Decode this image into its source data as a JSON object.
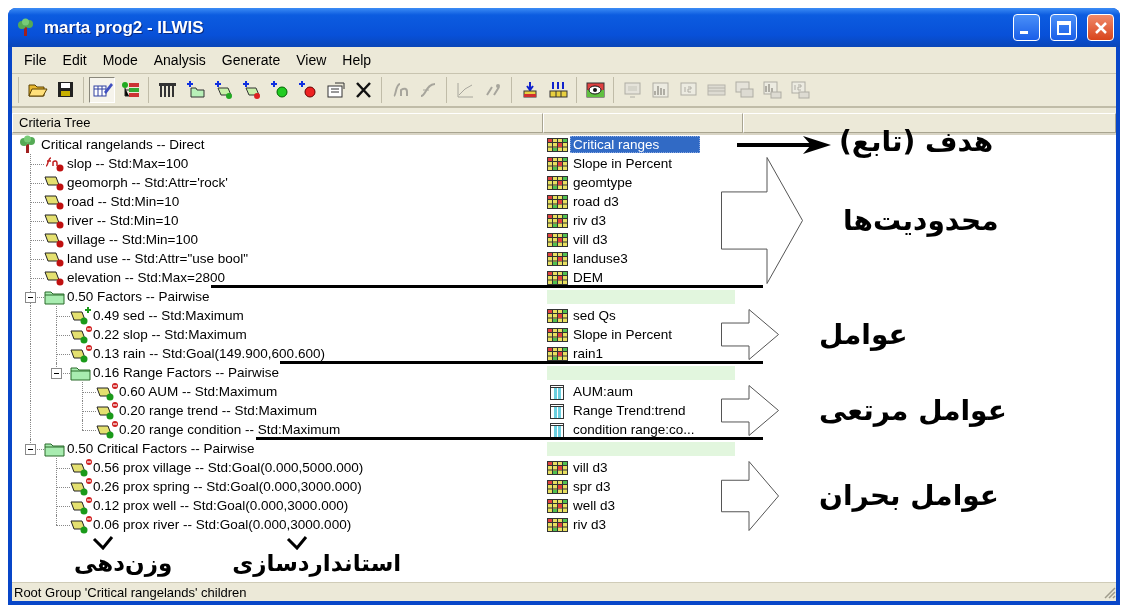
{
  "window": {
    "title": "marta prog2 - ILWIS"
  },
  "menu": [
    "File",
    "Edit",
    "Mode",
    "Analysis",
    "Generate",
    "View",
    "Help"
  ],
  "toolbar": [
    {
      "items": [
        {
          "kind": "open",
          "disabled": false,
          "pressed": false
        },
        {
          "kind": "save",
          "disabled": false,
          "pressed": false
        }
      ]
    },
    {
      "items": [
        {
          "kind": "edit-mode",
          "disabled": false,
          "pressed": true
        },
        {
          "kind": "tree-mode",
          "disabled": false,
          "pressed": false
        }
      ]
    },
    {
      "items": [
        {
          "kind": "columns",
          "disabled": false,
          "pressed": false
        },
        {
          "kind": "add-group",
          "disabled": false,
          "pressed": false
        },
        {
          "kind": "add-constraint",
          "disabled": false,
          "pressed": false
        },
        {
          "kind": "add-factor",
          "disabled": false,
          "pressed": false
        },
        {
          "kind": "add-benefit",
          "disabled": false,
          "pressed": false
        },
        {
          "kind": "add-cost",
          "disabled": false,
          "pressed": false
        },
        {
          "kind": "properties",
          "disabled": false,
          "pressed": false
        },
        {
          "kind": "delete",
          "disabled": false,
          "pressed": false
        }
      ]
    },
    {
      "items": [
        {
          "kind": "function",
          "disabled": true,
          "pressed": false
        },
        {
          "kind": "curve",
          "disabled": true,
          "pressed": false
        }
      ]
    },
    {
      "items": [
        {
          "kind": "graph",
          "disabled": true,
          "pressed": false
        },
        {
          "kind": "weights",
          "disabled": true,
          "pressed": false
        }
      ]
    },
    {
      "items": [
        {
          "kind": "stack",
          "disabled": false,
          "pressed": false
        },
        {
          "kind": "multi-stack",
          "disabled": false,
          "pressed": false
        }
      ]
    },
    {
      "items": [
        {
          "kind": "show-map",
          "disabled": false,
          "pressed": false
        }
      ]
    },
    {
      "items": [
        {
          "kind": "display",
          "disabled": true,
          "pressed": false
        },
        {
          "kind": "histogram",
          "disabled": true,
          "pressed": false
        },
        {
          "kind": "value",
          "disabled": true,
          "pressed": false
        },
        {
          "kind": "table",
          "disabled": true,
          "pressed": false
        },
        {
          "kind": "display-all",
          "disabled": true,
          "pressed": false
        },
        {
          "kind": "histogram-all",
          "disabled": true,
          "pressed": false
        },
        {
          "kind": "value-all",
          "disabled": true,
          "pressed": false
        }
      ]
    }
  ],
  "tree": {
    "header": "Criteria Tree",
    "root": {
      "kind": "root",
      "label": "Critical rangelands -- Direct",
      "map": {
        "kind": "raster",
        "label": "Critical ranges",
        "selected": true
      },
      "children": [
        {
          "kind": "function",
          "label": "slop -- Std:Max=100",
          "map": {
            "kind": "raster",
            "label": "Slope in Percent",
            "selected": false
          }
        },
        {
          "kind": "constraint",
          "label": "geomorph -- Std:Attr='rock'",
          "map": {
            "kind": "raster",
            "label": "geomtype",
            "selected": false
          }
        },
        {
          "kind": "constraint",
          "label": "road -- Std:Min=10",
          "map": {
            "kind": "raster",
            "label": "road d3",
            "selected": false
          }
        },
        {
          "kind": "constraint",
          "label": "river -- Std:Min=10",
          "map": {
            "kind": "raster",
            "label": "riv d3",
            "selected": false
          }
        },
        {
          "kind": "constraint",
          "label": "village -- Std:Min=100",
          "map": {
            "kind": "raster",
            "label": "vill d3",
            "selected": false
          }
        },
        {
          "kind": "constraint",
          "label": "land use -- Std:Attr=\"use bool\"",
          "map": {
            "kind": "raster",
            "label": "landuse3",
            "selected": false
          }
        },
        {
          "kind": "constraint",
          "label": "elevation -- Std:Max=2800",
          "map": {
            "kind": "raster",
            "label": "DEM",
            "selected": false
          }
        },
        {
          "kind": "group",
          "label": "0.50 Factors -- Pairwise",
          "expanded": true,
          "children": [
            {
              "kind": "benefit",
              "label": "0.49 sed -- Std:Maximum",
              "map": {
                "kind": "raster",
                "label": "sed Qs",
                "selected": false
              }
            },
            {
              "kind": "cost",
              "label": "0.22 slop -- Std:Maximum",
              "map": {
                "kind": "raster",
                "label": "Slope in Percent",
                "selected": false
              }
            },
            {
              "kind": "cost",
              "label": "0.13 rain -- Std:Goal(149.900,600.600)",
              "map": {
                "kind": "raster",
                "label": "rain1",
                "selected": false
              }
            },
            {
              "kind": "group",
              "label": "0.16 Range Factors -- Pairwise",
              "expanded": true,
              "children": [
                {
                  "kind": "cost",
                  "label": "0.60 AUM -- Std:Maximum",
                  "map": {
                    "kind": "table",
                    "label": "AUM:aum",
                    "selected": false
                  }
                },
                {
                  "kind": "cost",
                  "label": "0.20 range trend -- Std:Maximum",
                  "map": {
                    "kind": "table",
                    "label": "Range Trend:trend",
                    "selected": false
                  }
                },
                {
                  "kind": "cost",
                  "label": "0.20 range condition -- Std:Maximum",
                  "map": {
                    "kind": "table",
                    "label": "condition range:co...",
                    "selected": false
                  }
                }
              ]
            }
          ]
        },
        {
          "kind": "group",
          "label": "0.50 Critical Factors -- Pairwise",
          "expanded": true,
          "children": [
            {
              "kind": "cost",
              "label": "0.56 prox village -- Std:Goal(0.000,5000.000)",
              "map": {
                "kind": "raster",
                "label": "vill d3",
                "selected": false
              }
            },
            {
              "kind": "cost",
              "label": "0.26 prox spring -- Std:Goal(0.000,3000.000)",
              "map": {
                "kind": "raster",
                "label": "spr d3",
                "selected": false
              }
            },
            {
              "kind": "cost",
              "label": "0.12 prox well -- Std:Goal(0.000,3000.000)",
              "map": {
                "kind": "raster",
                "label": "well d3",
                "selected": false
              }
            },
            {
              "kind": "cost",
              "label": "0.06 prox river -- Std:Goal(0.000,3000.000)",
              "map": {
                "kind": "raster",
                "label": "riv d3",
                "selected": false
              }
            }
          ]
        }
      ]
    }
  },
  "annotations": [
    {
      "kind": "pointer",
      "label": "هدف (تابع)"
    },
    {
      "kind": "block",
      "label": "محدودیت‌ها"
    },
    {
      "kind": "block",
      "label": "عوامل"
    },
    {
      "kind": "block",
      "label": "عوامل مرتعی"
    },
    {
      "kind": "block",
      "label": "عوامل بحران"
    }
  ],
  "bottom_notes": [
    {
      "label": "استانداردسازی"
    },
    {
      "label": "وزن‌دهی"
    }
  ],
  "status_bar": "Root Group 'Critical rangelands' children"
}
